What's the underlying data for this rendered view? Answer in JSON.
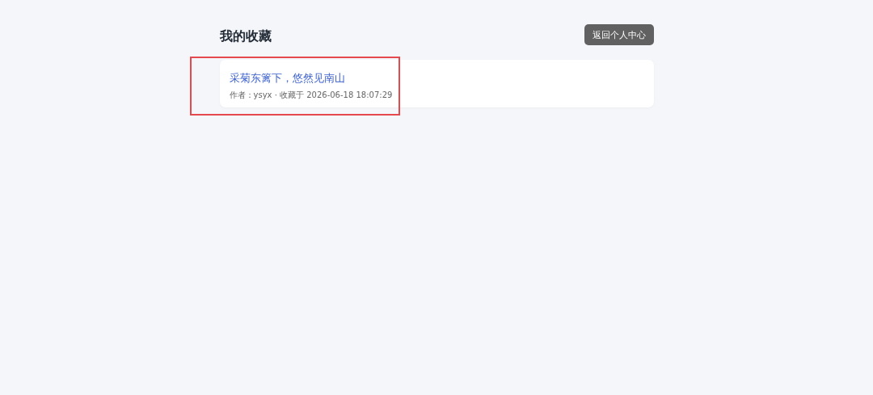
{
  "page": {
    "title": "我的收藏",
    "back_button": "返回个人中心"
  },
  "favorites": [
    {
      "title": "采菊东篱下，悠然见南山",
      "meta": "作者：ysyx · 收藏于 2026-06-18 18:07:29",
      "highlighted": true
    }
  ]
}
